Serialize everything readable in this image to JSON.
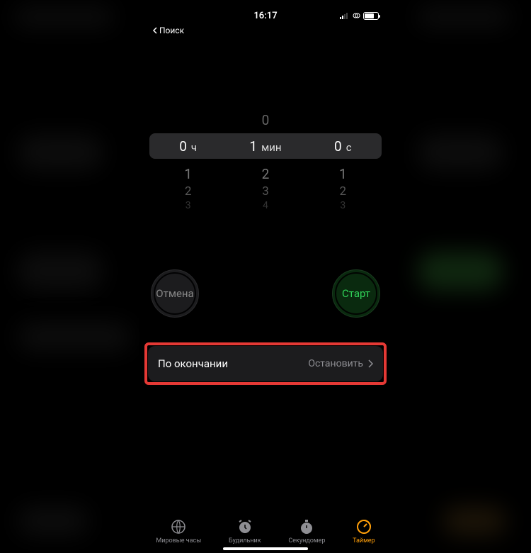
{
  "statusbar": {
    "time": "16:17",
    "back_label": "Поиск"
  },
  "picker": {
    "hours_value": "0",
    "hours_unit": "ч",
    "minutes_value": "1",
    "minutes_unit": "мин",
    "seconds_value": "0",
    "seconds_unit": "с",
    "above_min": "0",
    "below": {
      "h1": "1",
      "m1": "2",
      "s1": "1",
      "h2": "2",
      "m2": "3",
      "s2": "2",
      "h3": "3",
      "m3": "4",
      "s3": "3"
    }
  },
  "buttons": {
    "cancel": "Отмена",
    "start": "Старт"
  },
  "setting": {
    "label": "По окончании",
    "value": "Остановить"
  },
  "tabs": {
    "world_clock": "Мировые часы",
    "alarm": "Будильник",
    "stopwatch": "Секундомер",
    "timer": "Таймер"
  }
}
